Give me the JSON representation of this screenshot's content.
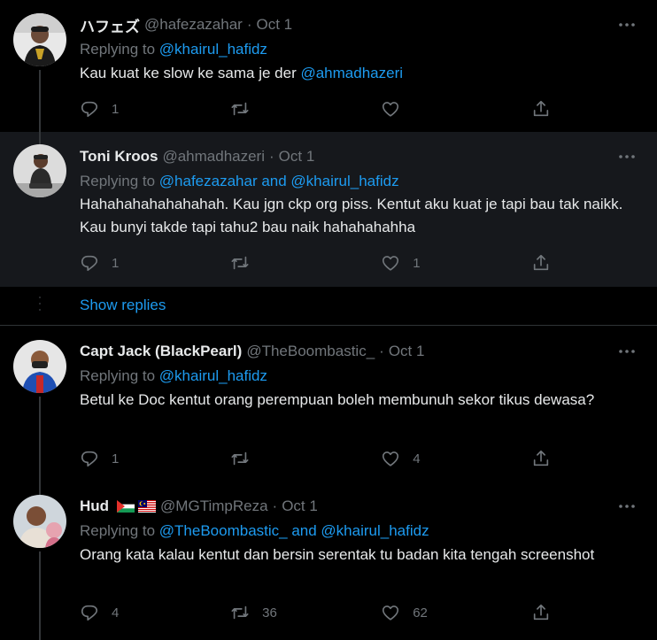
{
  "tweets": [
    {
      "name": "ハフェズ",
      "handle": "@hafezazahar",
      "date": "Oct 1",
      "replying_label": "Replying to ",
      "replying_to": "@khairul_hafidz",
      "text": "Kau kuat ke slow ke sama je der ",
      "mention": "@ahmadhazeri",
      "replies": "1",
      "retweets": "",
      "likes": ""
    },
    {
      "name": "Toni Kroos",
      "handle": "@ahmadhazeri",
      "date": "Oct 1",
      "replying_label": "Replying to ",
      "replying_to": "@hafezazahar and @khairul_hafidz",
      "text": "Hahahahahahahahah. Kau jgn ckp org piss. Kentut aku kuat je tapi bau tak naikk. Kau bunyi takde tapi tahu2 bau naik hahahahahha",
      "replies": "1",
      "retweets": "",
      "likes": "1"
    },
    {
      "name": "Capt Jack (BlackPearl)",
      "handle": "@TheBoombastic_",
      "date": "Oct 1",
      "replying_label": "Replying to ",
      "replying_to": "@khairul_hafidz",
      "text": "Betul ke Doc kentut orang perempuan boleh membunuh sekor tikus dewasa?",
      "replies": "1",
      "retweets": "",
      "likes": "4"
    },
    {
      "name": "Hud",
      "handle": "@MGTimpReza",
      "date": "Oct 1",
      "replying_label": "Replying to ",
      "replying_to": "@TheBoombastic_ and @khairul_hafidz",
      "text": "Orang kata kalau kentut dan bersin serentak tu badan kita tengah screenshot",
      "replies": "4",
      "retweets": "36",
      "likes": "62"
    }
  ],
  "show_replies": "Show replies",
  "separator_dot": "·",
  "icons": [
    "more-icon",
    "reply-icon",
    "retweet-icon",
    "like-icon",
    "share-icon",
    "palestine-flag-icon",
    "malaysia-flag-icon"
  ],
  "colors": {
    "background": "#000000",
    "highlight_background": "#16181c",
    "link": "#1d9bf0",
    "muted": "#71767b",
    "text": "#e7e9ea"
  }
}
